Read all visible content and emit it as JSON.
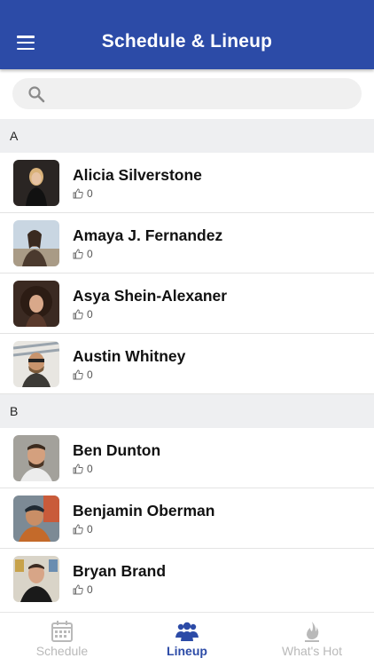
{
  "header": {
    "title": "Schedule & Lineup"
  },
  "search": {
    "placeholder": "",
    "value": ""
  },
  "sections": [
    {
      "letter": "A",
      "people": [
        {
          "name": "Alicia Silverstone",
          "likes": "0"
        },
        {
          "name": "Amaya J. Fernandez",
          "likes": "0"
        },
        {
          "name": "Asya Shein-Alexaner",
          "likes": "0"
        },
        {
          "name": "Austin Whitney",
          "likes": "0"
        }
      ]
    },
    {
      "letter": "B",
      "people": [
        {
          "name": "Ben Dunton",
          "likes": "0"
        },
        {
          "name": "Benjamin Oberman",
          "likes": "0"
        },
        {
          "name": "Bryan Brand",
          "likes": "0"
        }
      ]
    }
  ],
  "tabs": [
    {
      "label": "Schedule",
      "icon": "calendar-icon",
      "active": false
    },
    {
      "label": "Lineup",
      "icon": "users-icon",
      "active": true
    },
    {
      "label": "What's Hot",
      "icon": "flame-icon",
      "active": false
    }
  ],
  "colors": {
    "primary": "#2c4ba7",
    "section_bg": "#eeeff1",
    "inactive": "#b9b9b9"
  }
}
